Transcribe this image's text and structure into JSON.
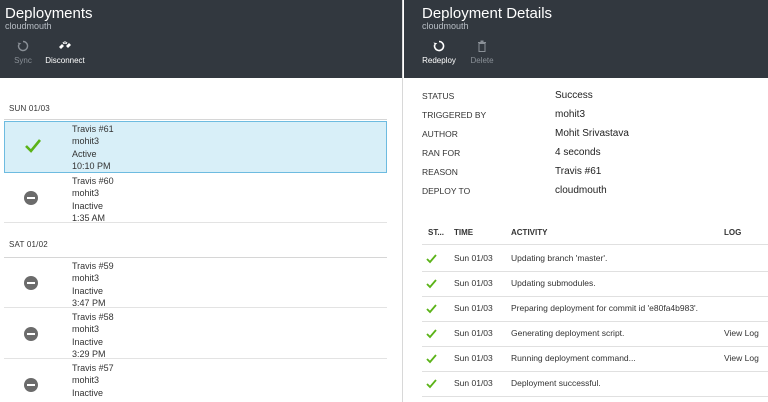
{
  "left": {
    "title": "Deployments",
    "subtitle": "cloudmouth",
    "commands": [
      {
        "label": "Sync",
        "icon": "sync-icon",
        "enabled": false
      },
      {
        "label": "Disconnect",
        "icon": "disconnect-icon",
        "enabled": true
      }
    ],
    "groups": [
      {
        "date": "SUN 01/03",
        "items": [
          {
            "name": "Travis #61",
            "author": "mohit3",
            "state": "Active",
            "time": "10:10 PM",
            "status": "success",
            "selected": true
          },
          {
            "name": "Travis #60",
            "author": "mohit3",
            "state": "Inactive",
            "time": "1:35 AM",
            "status": "inactive",
            "selected": false
          }
        ]
      },
      {
        "date": "SAT 01/02",
        "items": [
          {
            "name": "Travis #59",
            "author": "mohit3",
            "state": "Inactive",
            "time": "3:47 PM",
            "status": "inactive",
            "selected": false
          },
          {
            "name": "Travis #58",
            "author": "mohit3",
            "state": "Inactive",
            "time": "3:29 PM",
            "status": "inactive",
            "selected": false
          },
          {
            "name": "Travis #57",
            "author": "mohit3",
            "state": "Inactive",
            "time": "",
            "status": "inactive",
            "selected": false
          }
        ]
      }
    ]
  },
  "right": {
    "title": "Deployment Details",
    "subtitle": "cloudmouth",
    "commands": [
      {
        "label": "Redeploy",
        "icon": "redeploy-icon",
        "enabled": true
      },
      {
        "label": "Delete",
        "icon": "trash-icon",
        "enabled": false
      }
    ],
    "details": [
      {
        "key": "STATUS",
        "value": "Success"
      },
      {
        "key": "TRIGGERED BY",
        "value": "mohit3"
      },
      {
        "key": "AUTHOR",
        "value": "Mohit Srivastava"
      },
      {
        "key": "RAN FOR",
        "value": "4 seconds"
      },
      {
        "key": "REASON",
        "value": "Travis #61"
      },
      {
        "key": "DEPLOY TO",
        "value": "cloudmouth"
      }
    ],
    "log_headers": {
      "status": "ST...",
      "time": "TIME",
      "activity": "ACTIVITY",
      "log": "LOG"
    },
    "log_rows": [
      {
        "time": "Sun 01/03",
        "activity": "Updating branch 'master'.",
        "log": ""
      },
      {
        "time": "Sun 01/03",
        "activity": "Updating submodules.",
        "log": ""
      },
      {
        "time": "Sun 01/03",
        "activity": "Preparing deployment for commit id 'e80fa4b983'.",
        "log": ""
      },
      {
        "time": "Sun 01/03",
        "activity": "Generating deployment script.",
        "log": "View Log"
      },
      {
        "time": "Sun 01/03",
        "activity": "Running deployment command...",
        "log": "View Log"
      },
      {
        "time": "Sun 01/03",
        "activity": "Deployment successful.",
        "log": ""
      }
    ]
  },
  "colors": {
    "header_bg": "#32383f",
    "success_green": "#5bb318",
    "selected_bg": "#d8eff8",
    "selected_border": "#6dbbe0",
    "inactive_gray": "#6b6b6b"
  }
}
